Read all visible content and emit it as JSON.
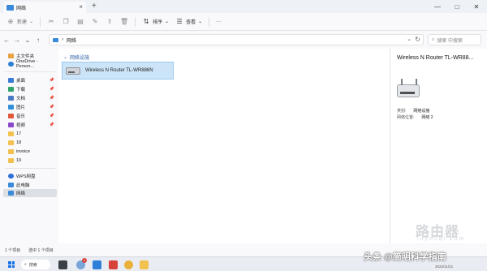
{
  "window": {
    "tab_title": "网络",
    "tab_close": "×",
    "new_tab": "+",
    "controls": [
      "—",
      "□",
      "✕"
    ]
  },
  "toolbar": {
    "new_label": "新建",
    "sort_label": "排序",
    "view_label": "查看",
    "more_label": "···"
  },
  "address": {
    "path": "网络",
    "search_placeholder": "搜索 中搜索"
  },
  "sidebar": {
    "items": [
      {
        "label": "主文件夹",
        "icon": "home-icon",
        "color": "#e7a440"
      },
      {
        "label": "OneDrive - Person...",
        "icon": "cloud-icon",
        "color": "#2e7fd6"
      },
      {
        "label": "桌面",
        "icon": "desktop-icon",
        "color": "#3a7bd5",
        "pinned": true
      },
      {
        "label": "下载",
        "icon": "download-icon",
        "color": "#2fa36b",
        "pinned": true
      },
      {
        "label": "文档",
        "icon": "document-icon",
        "color": "#4a78c2",
        "pinned": true
      },
      {
        "label": "图片",
        "icon": "pictures-icon",
        "color": "#2f8fd8",
        "pinned": true
      },
      {
        "label": "音乐",
        "icon": "music-icon",
        "color": "#e05a3a",
        "pinned": true
      },
      {
        "label": "视频",
        "icon": "video-icon",
        "color": "#8b47c9",
        "pinned": true
      },
      {
        "label": "17",
        "icon": "folder-icon",
        "color": "#f2c14e"
      },
      {
        "label": "18",
        "icon": "folder-icon",
        "color": "#f2c14e"
      },
      {
        "label": "invoice",
        "icon": "folder-icon",
        "color": "#f2c14e"
      },
      {
        "label": "19",
        "icon": "folder-icon",
        "color": "#f2c14e"
      },
      {
        "label": "WPS网盘",
        "icon": "cloud-drive-icon",
        "color": "#2f6fd8"
      },
      {
        "label": "此电脑",
        "icon": "computer-icon",
        "color": "#3b8ad9"
      },
      {
        "label": "网络",
        "icon": "network-icon",
        "color": "#3b8ad9",
        "selected": true
      }
    ]
  },
  "content": {
    "group_header": "网络设施",
    "device_name": "Wireless N Router TL-WR886N"
  },
  "details": {
    "title": "Wireless N Router TL-WR88...",
    "rows": [
      {
        "key": "类别:",
        "value": "网络设施"
      },
      {
        "key": "网络位置:",
        "value": "网络 2"
      }
    ]
  },
  "status": {
    "count": "1 个项目",
    "selected": "选中 1 个项目"
  },
  "taskbar": {
    "search_label": "搜索",
    "badge": "1",
    "date": "2022/11/21"
  },
  "watermark": {
    "logo_text": "路由器",
    "logo_sub": "luyouqi.com",
    "caption": "头条 @简明科学指南"
  }
}
